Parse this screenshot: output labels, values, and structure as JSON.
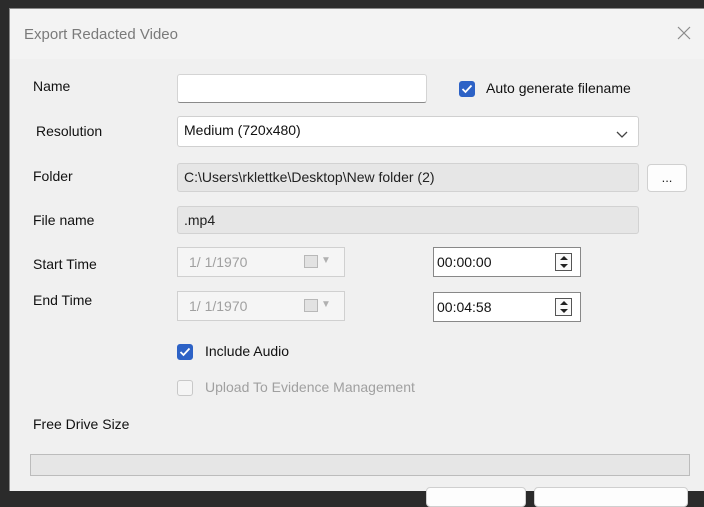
{
  "window": {
    "title": "Export Redacted Video",
    "close_icon": "close-icon"
  },
  "form": {
    "name_label": "Name",
    "name_value": "",
    "auto_generate_label": "Auto generate filename",
    "auto_generate_checked": true,
    "resolution_label": "Resolution",
    "resolution_value": "Medium (720x480)",
    "folder_label": "Folder",
    "folder_value": "C:\\Users\\rklettke\\Desktop\\New folder (2)",
    "browse_label": "...",
    "filename_label": "File name",
    "filename_value": ".mp4",
    "start_time_label": "Start Time",
    "start_date": "1/ 1/1970",
    "start_time": "00:00:00",
    "end_time_label": "End Time",
    "end_date": "1/ 1/1970",
    "end_time": "00:04:58",
    "include_audio_label": "Include Audio",
    "include_audio_checked": true,
    "upload_label": "Upload To Evidence Management",
    "upload_checked": false,
    "free_drive_label": "Free Drive Size",
    "free_drive_progress": 0
  },
  "colors": {
    "accent": "#2d62c6",
    "dialog_bg": "#f0f0f0",
    "disabled_text": "#a0a0a0"
  }
}
